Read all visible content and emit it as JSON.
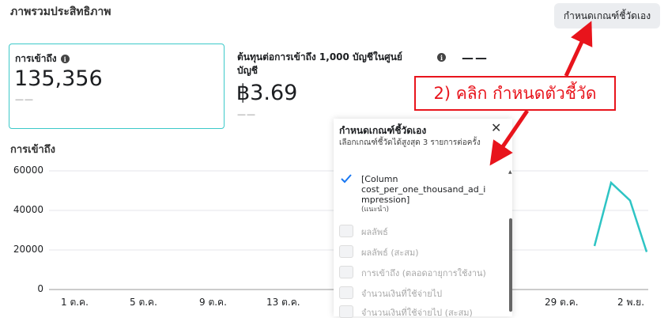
{
  "header": {
    "title": "ภาพรวมประสิทธิภาพ",
    "customize_button": "กำหนดเกณฑ์ชี้วัดเอง"
  },
  "cards": {
    "reach": {
      "label": "การเข้าถึง",
      "value": "135,356",
      "comparison": "——"
    },
    "cpm": {
      "label": "ต้นทุนต่อการเข้าถึง 1,000 บัญชีในศูนย์บัญชี",
      "value": "฿3.69",
      "comparison": "——"
    },
    "third": {
      "value": "——"
    }
  },
  "annotation": {
    "text": "2) คลิก กำหนดตัวชี้วัด"
  },
  "panel": {
    "title": "กำหนดเกณฑ์ชี้วัดเอง",
    "close": "✕",
    "subtitle": "เลือกเกณฑ์ชี้วัดได้สูงสุด 3 รายการต่อครั้ง",
    "options": [
      {
        "line1": "[Column",
        "line2": "cost_per_one_thousand_ad_i",
        "line3": "mpression]",
        "note": "(แนะนำ)",
        "checked": true
      },
      {
        "label": "ผลลัพธ์",
        "checked": false
      },
      {
        "label": "ผลลัพธ์ (สะสม)",
        "checked": false
      },
      {
        "label": "การเข้าถึง (ตลอดอายุการใช้งาน)",
        "checked": false
      },
      {
        "label": "จำนวนเงินที่ใช้จ่ายไป",
        "checked": false
      },
      {
        "label": "จำนวนเงินที่ใช้จ่ายไป (สะสม)",
        "checked": false
      }
    ]
  },
  "chart_data": {
    "type": "line",
    "title": "การเข้าถึง",
    "yticks": [
      "60000",
      "40000",
      "20000",
      "0"
    ],
    "ylim": [
      0,
      60000
    ],
    "xticks": [
      "1 ต.ค.",
      "5 ต.ค.",
      "9 ต.ค.",
      "13 ต.ค.",
      "29 ต.ค.",
      "2 พ.ย."
    ],
    "series": [
      {
        "color": "#2ec4c4",
        "values": [
          22000,
          54000,
          45000,
          19000
        ]
      }
    ],
    "grid": true
  },
  "colors": {
    "accent": "#2ec4c4",
    "annotation": "#e8141c",
    "check": "#1877f2"
  }
}
